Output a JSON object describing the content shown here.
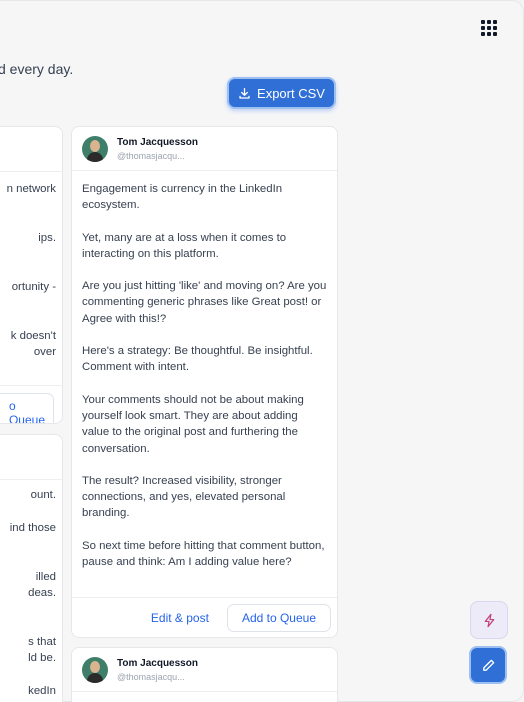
{
  "header": {
    "subtitle": "d every day.",
    "export_label": "Export CSV",
    "grid_icon": "grid-icon",
    "download_icon": "download-icon"
  },
  "left_column": {
    "card1_lines": [
      "n network",
      "ips.",
      "ortunity -",
      "k doesn't",
      "over"
    ],
    "card1_queue_label": "o Queue",
    "card2_lines": [
      "ount.",
      "ind those",
      "illed",
      "deas.",
      "s that",
      "ld be.",
      "kedIn"
    ]
  },
  "main_card": {
    "author": "Tom Jacquesson",
    "handle": "@thomasjacqu...",
    "paragraphs": [
      "Engagement is currency in the LinkedIn ecosystem.",
      "Yet, many are at a loss when it comes to interacting on this platform.",
      "Are you just hitting 'like' and moving on? Are you commenting generic phrases like Great post! or Agree with this!?",
      "Here's a strategy: Be thoughtful. Be insightful. Comment with intent.",
      "Your comments should not be about making yourself look smart. They are about adding value to the original post and furthering the conversation.",
      "The result? Increased visibility, stronger connections, and yes, elevated personal branding.",
      "So next time before hitting that comment button, pause and think: Am I adding value here?"
    ],
    "edit_label": "Edit & post",
    "queue_label": "Add to Queue"
  },
  "second_card": {
    "author": "Tom Jacquesson",
    "handle": "@thomasjacqu..."
  },
  "colors": {
    "accent": "#2f6fd6",
    "link": "#2563eb"
  }
}
